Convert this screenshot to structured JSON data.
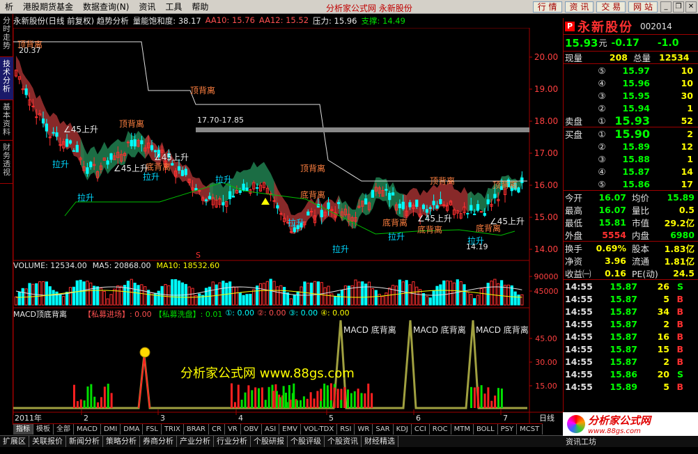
{
  "menubar": {
    "items": [
      "析",
      "港股期货基金",
      "数据查询(N)",
      "资讯",
      "工具",
      "帮助"
    ],
    "center_title": "分析家公式网  永新股份",
    "buttons": [
      "行 情",
      "资 讯",
      "交 易",
      "网 站"
    ]
  },
  "left_tabs": [
    "分时走势",
    "技术分析",
    "基本资料",
    "财务透视"
  ],
  "kline_header": {
    "title": "永新股份(日线 前复权) 趋势分析",
    "saturation": "量能饱和度: 38.17",
    "aa10": "AA10: 15.76",
    "aa12": "AA12: 15.52",
    "pressure": "压力: 15.96",
    "support": "支撑: 14.49"
  },
  "price_axis": [
    "20.00",
    "19.00",
    "18.00",
    "17.00",
    "16.00",
    "15.00",
    "14.00"
  ],
  "volume_axis": [
    "90000",
    "45000"
  ],
  "macd_axis": [
    "45.00",
    "30.00",
    "15.00"
  ],
  "date_axis": [
    "2011年",
    "2",
    "3",
    "4",
    "5",
    "6",
    "7"
  ],
  "annotations": {
    "top_div": "顶背离",
    "bottom_div": "底背离",
    "pull_up": "拉升",
    "rise45": "∠45上升",
    "range_label": "17.70-17.85",
    "high_price": "20.37",
    "low_price": "14.19",
    "macd_bottom_div": "MACD 底背离",
    "watermark": "分析家公式网  www.88gs.com",
    "s_marker": "S"
  },
  "volume_header": {
    "volume": "VOLUME: 12534.00",
    "ma5": "MA5: 20868.00",
    "ma10": "MA10: 18532.60"
  },
  "macd_header": {
    "title": "MACD顶底背离",
    "item1": "【私募进场】: 0.00",
    "item2": "【私募洗盘】: 0.01",
    "item3": "①: 0.00",
    "item4": "②: 0.00",
    "item5": "③: 0.00",
    "item6": "④: 0.00"
  },
  "indicator_tabs": [
    "指标",
    "模板",
    "全部",
    "MACD",
    "DMI",
    "DMA",
    "FSL",
    "TRIX",
    "BRAR",
    "CR",
    "VR",
    "OBV",
    "ASI",
    "EMV",
    "VOL-TDX",
    "RSI",
    "WR",
    "SAR",
    "KDJ",
    "CCI",
    "ROC",
    "MTM",
    "BOLL",
    "PSY",
    "MCST"
  ],
  "period_label": "日线",
  "nav_tabs": [
    "扩展区",
    "关联报价",
    "新闻分析",
    "策略分析",
    "券商分析",
    "产业分析",
    "行业分析",
    "个股研报",
    "个股评级",
    "个股资讯",
    "财经精选"
  ],
  "nav_right": "资讯工坊",
  "stock": {
    "badge": "P",
    "name": "永新股份",
    "code": "002014",
    "price": "15.93",
    "unit": "元",
    "change": "-0.17",
    "change_pct": "-1.0",
    "now_vol_label": "现量",
    "now_vol": "208",
    "total_vol_label": "总量",
    "total_vol": "12534"
  },
  "sell_orders": [
    {
      "idx": "⑤",
      "price": "15.97",
      "vol": "10"
    },
    {
      "idx": "④",
      "price": "15.96",
      "vol": "10"
    },
    {
      "idx": "③",
      "price": "15.95",
      "vol": "30"
    },
    {
      "idx": "②",
      "price": "15.94",
      "vol": "1"
    },
    {
      "idx": "①",
      "price": "15.93",
      "vol": "52",
      "label": "卖盘"
    }
  ],
  "buy_orders": [
    {
      "idx": "①",
      "price": "15.90",
      "vol": "2",
      "label": "买盘"
    },
    {
      "idx": "②",
      "price": "15.89",
      "vol": "12"
    },
    {
      "idx": "③",
      "price": "15.88",
      "vol": "1"
    },
    {
      "idx": "④",
      "price": "15.87",
      "vol": "14"
    },
    {
      "idx": "⑤",
      "price": "15.86",
      "vol": "17"
    }
  ],
  "quote_stats": [
    {
      "l1": "今开",
      "v1": "16.07",
      "l2": "均价",
      "v2": "15.89"
    },
    {
      "l1": "最高",
      "v1": "16.07",
      "l2": "量比",
      "v2": "0.5"
    },
    {
      "l1": "最低",
      "v1": "15.81",
      "l2": "市值",
      "v2": "29.2亿"
    },
    {
      "l1": "外盘",
      "v1": "5554",
      "l2": "内盘",
      "v2": "6980"
    }
  ],
  "fund_stats": [
    {
      "l1": "换手",
      "v1": "0.69%",
      "l2": "股本",
      "v2": "1.83亿"
    },
    {
      "l1": "净资",
      "v1": "3.96",
      "l2": "流通",
      "v2": "1.81亿"
    },
    {
      "l1": "收益㈠",
      "v1": "0.16",
      "l2": "PE(动)",
      "v2": "24.5"
    }
  ],
  "ticks": [
    {
      "t": "14:55",
      "p": "15.87",
      "v": "26",
      "d": "S"
    },
    {
      "t": "14:55",
      "p": "15.87",
      "v": "5",
      "d": "B"
    },
    {
      "t": "14:55",
      "p": "15.87",
      "v": "34",
      "d": "B"
    },
    {
      "t": "14:55",
      "p": "15.87",
      "v": "2",
      "d": "B"
    },
    {
      "t": "14:55",
      "p": "15.87",
      "v": "16",
      "d": "B"
    },
    {
      "t": "14:55",
      "p": "15.87",
      "v": "15",
      "d": "B"
    },
    {
      "t": "14:55",
      "p": "15.87",
      "v": "2",
      "d": "B"
    },
    {
      "t": "14:55",
      "p": "15.86",
      "v": "20",
      "d": "S"
    },
    {
      "t": "14:55",
      "p": "15.89",
      "v": "5",
      "d": "B"
    }
  ],
  "logo": {
    "t1": "分析家公式网",
    "t2": "www.88gs.com"
  },
  "colors": {
    "up": "#ff3030",
    "down": "#00ffff",
    "accent": "#a00000"
  }
}
